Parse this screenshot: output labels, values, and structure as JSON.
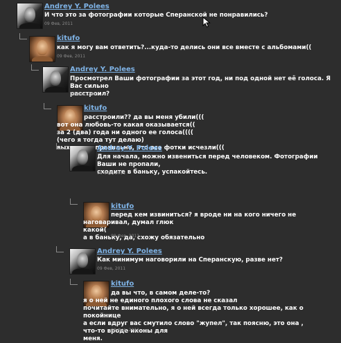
{
  "comments": [
    {
      "author": "Andrey Y. Polees",
      "text": "И что это за фотографии которые Сперанской не понравились?",
      "date": "09 Фев, 2011",
      "avatar_icon": "andrey-avatar"
    },
    {
      "author": "kitufo",
      "text": "как я могу вам ответить?...куда-то делись они все вместе с альбомами((",
      "date": "09 Фев, 2011",
      "avatar_icon": "kitufo-avatar"
    },
    {
      "author": "Andrey Y. Polees",
      "text": "Просмотрел Ваши фотографии за этот год, ни под одной нет её голоса. Я Вас сильно\nрасстроил?",
      "date": "09 Фев, 2011",
      "avatar_icon": "andrey-avatar"
    },
    {
      "author": "kitufo",
      "text": "расстроили?? да вы меня убили(((\nвот она любовь-то какая оказывается((\nза 2 (два) года ни одного ее голоса((((\n(чего я тогда тут делаю)\nвыходит и правильно, что все фотки исчезли(((",
      "date": "09 Фев, 2011",
      "avatar_icon": "kitufo-avatar"
    },
    {
      "author": "Andrey Y. Polees",
      "text": "Для начала, можно извениться перед человеком. Фотографии Ваши не пропали,\nсходите в баньку, успакойтесь.",
      "date": "09 Фев, 2011",
      "avatar_icon": "andrey-avatar"
    },
    {
      "author": "kitufo",
      "text": "перед кем извиниться? я вроде ни на кого ничего не наговаривал, думал глюк\nкакой(\nа в баньку, да, схожу обязательно",
      "date": "09 Фев, 2011",
      "avatar_icon": "kitufo-avatar"
    },
    {
      "author": "Andrey Y. Polees",
      "text": "Как минимум наговорили на Сперанскую, разве нет?",
      "date": "09 Фев, 2011",
      "avatar_icon": "andrey-avatar"
    },
    {
      "author": "kitufo",
      "text": "да вы что, в самом деле-то?\nя о ней не единого плохого слова не сказал\nпочитайте внимательно, я о ней всегда только хорошее, как о покойнице\nа если вдруг вас смутило слово \"жупел\", так поясню, это она , что-то вроде иконы для\nменя.",
      "date": "09 Фев, 2011",
      "avatar_icon": "kitufo-avatar"
    }
  ]
}
